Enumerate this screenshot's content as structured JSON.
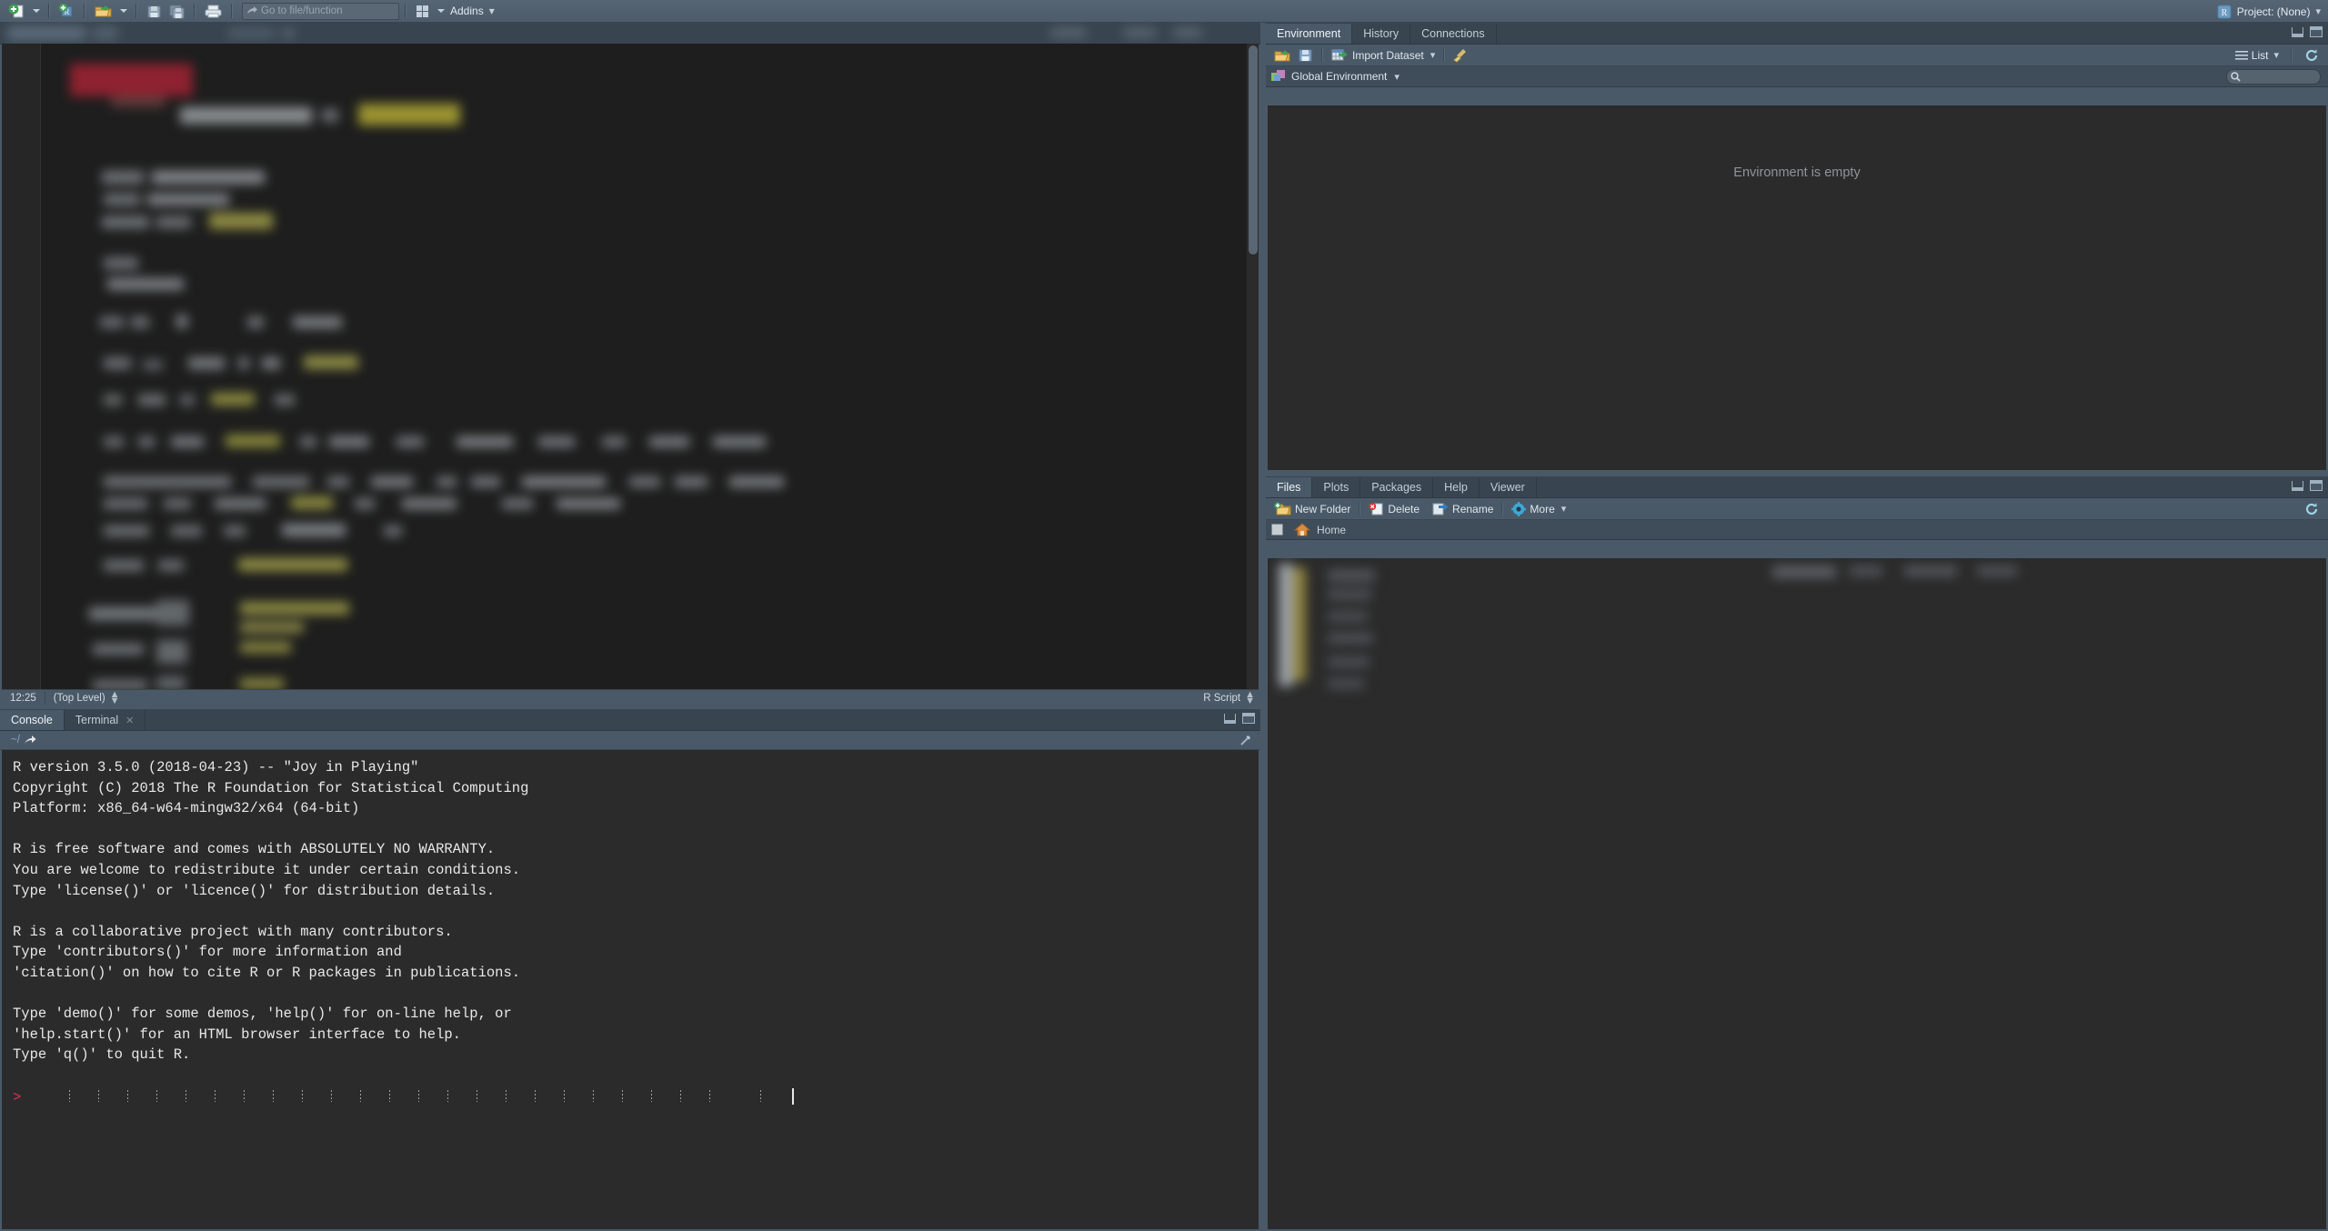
{
  "app": {
    "title": "RStudio",
    "theme_accent": "#4a5968",
    "editor_bg": "#2b2b2b"
  },
  "toolbar": {
    "new_file": {
      "name": "new-file",
      "icon": "new-file-icon",
      "has_menu": true
    },
    "new_project": {
      "name": "new-project",
      "icon": "new-project-icon"
    },
    "open_file": {
      "name": "open-file",
      "icon": "open-folder-icon",
      "has_menu": true
    },
    "save": {
      "name": "save",
      "icon": "save-icon"
    },
    "save_all": {
      "name": "save-all",
      "icon": "save-all-icon"
    },
    "print": {
      "name": "print",
      "icon": "print-icon"
    },
    "goto": {
      "placeholder": "Go to file/function",
      "value": ""
    },
    "workspace_panes": {
      "name": "workspace-panes",
      "icon": "panes-icon",
      "has_menu": true
    },
    "addins_label": "Addins",
    "project_label": "Project: (None)"
  },
  "environment_pane": {
    "tabs": [
      {
        "label": "Environment",
        "active": true
      },
      {
        "label": "History",
        "active": false
      },
      {
        "label": "Connections",
        "active": false
      }
    ],
    "toolbar": [
      {
        "label": "",
        "icon": "load-workspace-icon"
      },
      {
        "label": "",
        "icon": "save-workspace-icon"
      },
      {
        "label": "Import Dataset",
        "icon": "import-dataset-icon",
        "has_menu": true
      },
      {
        "label": "",
        "icon": "broom-clear-icon"
      }
    ],
    "view_mode": "List",
    "refresh_icon": "refresh-icon",
    "scope": "Global Environment",
    "search_placeholder": "",
    "empty_message": "Environment is empty"
  },
  "files_pane": {
    "tabs": [
      {
        "label": "Files",
        "active": true
      },
      {
        "label": "Plots",
        "active": false
      },
      {
        "label": "Packages",
        "active": false
      },
      {
        "label": "Help",
        "active": false
      },
      {
        "label": "Viewer",
        "active": false
      }
    ],
    "toolbar": [
      {
        "label": "New Folder",
        "icon": "new-folder-icon"
      },
      {
        "label": "Delete",
        "icon": "delete-icon"
      },
      {
        "label": "Rename",
        "icon": "rename-icon"
      },
      {
        "label": "More",
        "icon": "gear-icon",
        "has_menu": true
      }
    ],
    "path_label": "Home",
    "path_icon": "home-icon",
    "refresh_icon": "refresh-icon"
  },
  "source_pane": {
    "status": {
      "cursor_position": "12:25",
      "scope": "(Top Level)",
      "file_type": "R Script"
    }
  },
  "console_pane": {
    "tabs": [
      {
        "label": "Console",
        "active": true,
        "closable": false
      },
      {
        "label": "Terminal",
        "active": false,
        "closable": true
      }
    ],
    "working_directory": "~/",
    "prompt_symbol": ">",
    "input_value": "",
    "output_lines": [
      "R version 3.5.0 (2018-04-23) -- \"Joy in Playing\"",
      "Copyright (C) 2018 The R Foundation for Statistical Computing",
      "Platform: x86_64-w64-mingw32/x64 (64-bit)",
      "",
      "R is free software and comes with ABSOLUTELY NO WARRANTY.",
      "You are welcome to redistribute it under certain conditions.",
      "Type 'license()' or 'licence()' for distribution details.",
      "",
      "R is a collaborative project with many contributors.",
      "Type 'contributors()' for more information and",
      "'citation()' on how to cite R or R packages in publications.",
      "",
      "Type 'demo()' for some demos, 'help()' for on-line help, or",
      "'help.start()' for an HTML browser interface to help.",
      "Type 'q()' to quit R."
    ]
  }
}
